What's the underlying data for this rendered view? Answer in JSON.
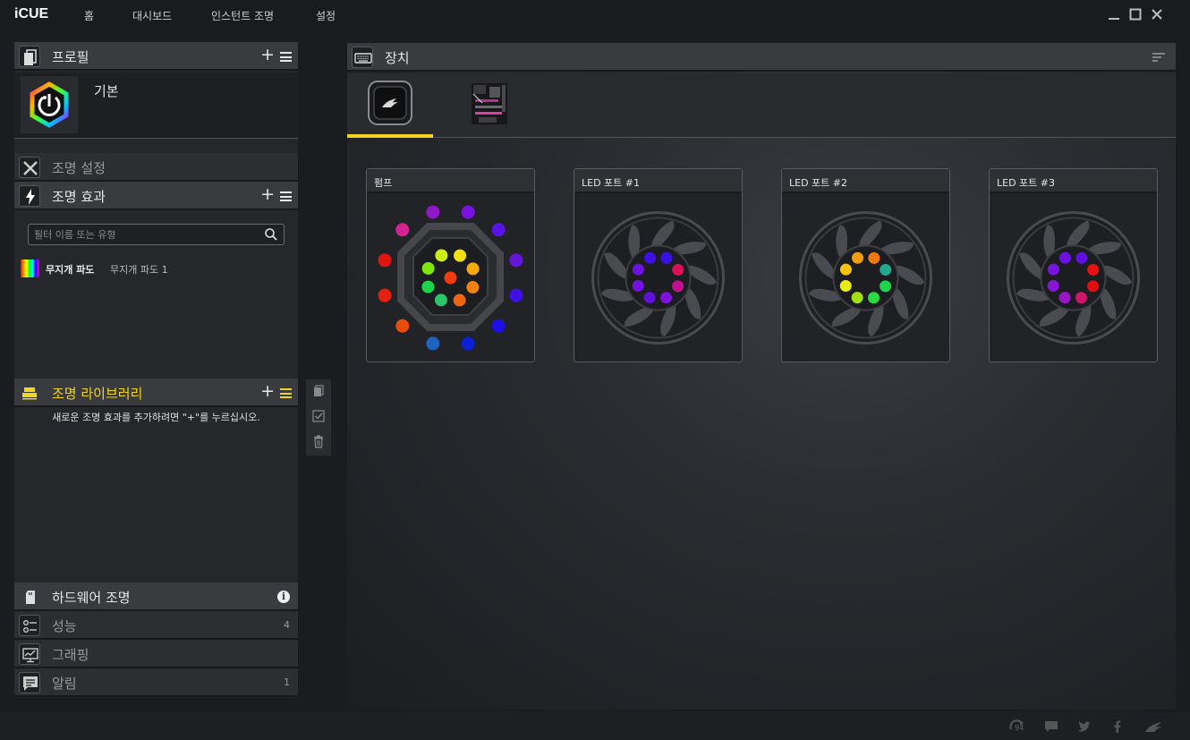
{
  "app": {
    "logo": "iCUE"
  },
  "nav": {
    "home": "홈",
    "dashboard": "대시보드",
    "instant_lighting": "인스턴트 조명",
    "settings": "설정"
  },
  "profiles": {
    "title": "프로필",
    "plus": "+",
    "items": [
      {
        "name": "기본"
      }
    ]
  },
  "lighting_setup": {
    "title": "조명 설정"
  },
  "lighting_effects": {
    "title": "조명 효과",
    "plus": "+",
    "filter_placeholder": "필터 이름 또는 유형",
    "items": [
      {
        "type": "무지개 파도",
        "name": "무지개 파도 1"
      }
    ]
  },
  "lighting_library": {
    "title": "조명 라이브러리",
    "plus": "+",
    "message": "새로운 조명 효과를 추가하려면 \"+\"를 누르십시오."
  },
  "hardware_lighting": {
    "title": "하드웨어 조명",
    "info": "i"
  },
  "performance": {
    "title": "성능",
    "count": "4"
  },
  "graphing": {
    "title": "그래핑"
  },
  "notifications": {
    "title": "알림",
    "count": "1"
  },
  "devices": {
    "title": "장치",
    "tabs": [
      {
        "name": "cooler-pump",
        "active": true
      },
      {
        "name": "motherboard",
        "active": false
      }
    ],
    "zones": [
      {
        "title": "펌프",
        "type": "pump",
        "outer_leds": [
          "#8f17c8",
          "#7812e0",
          "#5a14e8",
          "#6616d8",
          "#3f10e6",
          "#1d0fe8",
          "#0d1fd6",
          "#1f63c0",
          "#ea4a0a",
          "#e8200f",
          "#e0150f",
          "#d42290"
        ],
        "inner_leds": [
          "#ccee0b",
          "#f5e012",
          "#f7a80c",
          "#f08212",
          "#f2640e",
          "#2cc66a",
          "#1ed44a",
          "#7fe60c",
          "#f03d10"
        ]
      },
      {
        "title": "LED 포트 #1",
        "type": "fan",
        "leds": [
          "#3f10e6",
          "#3b10e8",
          "#dc1058",
          "#c01290",
          "#7d12d8",
          "#6010d8",
          "#7212e0",
          "#6a12e0"
        ]
      },
      {
        "title": "LED 포트 #2",
        "type": "fan",
        "leds": [
          "#f29d10",
          "#f07810",
          "#23a890",
          "#1ed44a",
          "#2cd840",
          "#a0e010",
          "#e8ec0f",
          "#f5c50a"
        ]
      },
      {
        "title": "LED 포트 #3",
        "type": "fan",
        "leds": [
          "#6a12e0",
          "#5f10e2",
          "#e81010",
          "#e01010",
          "#d0146a",
          "#9a16c6",
          "#8616d4",
          "#7814dc"
        ]
      }
    ]
  },
  "statusbar": {
    "update_count": "94",
    "icons": [
      "update-icon",
      "chat-icon",
      "twitter-icon",
      "facebook-icon",
      "corsair-icon"
    ]
  },
  "colors": {
    "accent": "#f2d422",
    "bg": "#1b1c1f",
    "panel": "#26272a",
    "header": "#3a3b3f"
  }
}
